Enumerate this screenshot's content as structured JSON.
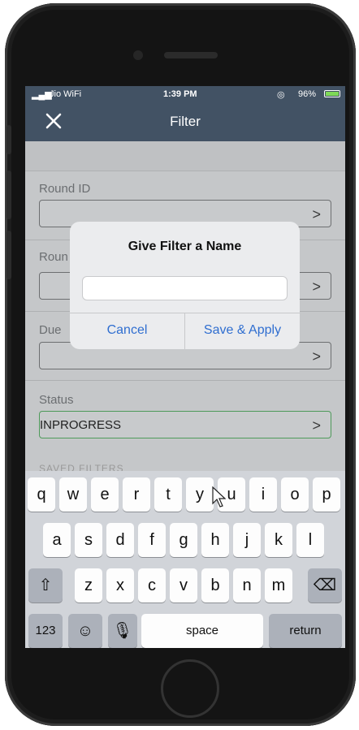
{
  "status_bar": {
    "carrier": "Jio WiFi",
    "time": "1:39 PM",
    "battery": "96%"
  },
  "nav": {
    "title": "Filter",
    "close_icon": "close-icon"
  },
  "fields": [
    {
      "label": "Round ID",
      "value": ""
    },
    {
      "label": "Roun",
      "value": ""
    },
    {
      "label": "Due",
      "value": ""
    },
    {
      "label": "Status",
      "value": "INPROGRESS"
    }
  ],
  "saved_filters_label": "SAVED FILTERS",
  "dialog": {
    "title": "Give Filter a Name",
    "input_value": "",
    "cancel": "Cancel",
    "save": "Save & Apply"
  },
  "keyboard": {
    "row1": [
      "q",
      "w",
      "e",
      "r",
      "t",
      "y",
      "u",
      "i",
      "o",
      "p"
    ],
    "row2": [
      "a",
      "s",
      "d",
      "f",
      "g",
      "h",
      "j",
      "k",
      "l"
    ],
    "row3": [
      "z",
      "x",
      "c",
      "v",
      "b",
      "n",
      "m"
    ],
    "shift": "shift-icon",
    "backspace": "backspace-icon",
    "numbers": "123",
    "emoji": "emoji-icon",
    "mic": "mic-icon",
    "space": "space",
    "return": "return"
  },
  "colors": {
    "nav_bg": "#425264",
    "dialog_button": "#2f6ed0",
    "status_border": "#4e9a5a"
  }
}
